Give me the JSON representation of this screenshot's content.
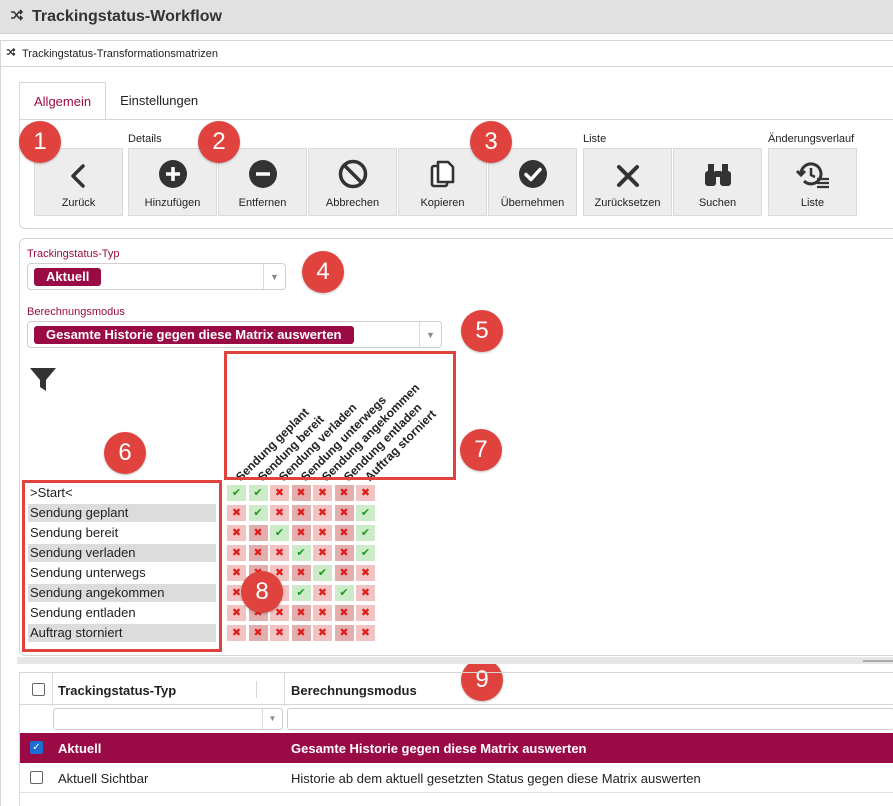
{
  "window": {
    "title": "Trackingstatus-Workflow"
  },
  "subwindow": {
    "title": "Trackingstatus-Transformationsmatrizen"
  },
  "tabs": [
    {
      "label": "Allgemein",
      "active": true
    },
    {
      "label": "Einstellungen",
      "active": false
    }
  ],
  "toolbar": {
    "groups": {
      "details": "Details",
      "liste": "Liste",
      "history": "Änderungsverlauf"
    },
    "buttons": {
      "back": "Zurück",
      "add": "Hinzufügen",
      "remove": "Entfernen",
      "cancel": "Abbrechen",
      "copy": "Kopieren",
      "apply": "Übernehmen",
      "reset": "Zurücksetzen",
      "search": "Suchen",
      "list": "Liste"
    }
  },
  "form": {
    "type_label": "Trackingstatus-Typ",
    "type_value": "Aktuell",
    "mode_label": "Berechnungsmodus",
    "mode_value": "Gesamte Historie gegen diese Matrix auswerten"
  },
  "matrix": {
    "columns": [
      "Sendung geplant",
      "Sendung bereit",
      "Sendung verladen",
      "Sendung unterwegs",
      "Sendung angekommen",
      "Sendung entladen",
      "Auftrag storniert"
    ],
    "rows": [
      {
        "label": ">Start<",
        "cells": [
          1,
          1,
          0,
          0,
          0,
          0,
          0
        ]
      },
      {
        "label": "Sendung geplant",
        "cells": [
          0,
          1,
          0,
          0,
          0,
          0,
          1
        ]
      },
      {
        "label": "Sendung bereit",
        "cells": [
          0,
          0,
          1,
          0,
          0,
          0,
          1
        ]
      },
      {
        "label": "Sendung verladen",
        "cells": [
          0,
          0,
          0,
          1,
          0,
          0,
          1
        ]
      },
      {
        "label": "Sendung unterwegs",
        "cells": [
          0,
          0,
          0,
          0,
          1,
          0,
          0
        ]
      },
      {
        "label": "Sendung angekommen",
        "cells": [
          0,
          0,
          0,
          1,
          0,
          1,
          0
        ]
      },
      {
        "label": "Sendung entladen",
        "cells": [
          0,
          0,
          0,
          0,
          0,
          0,
          0
        ]
      },
      {
        "label": "Auftrag storniert",
        "cells": [
          0,
          0,
          0,
          0,
          0,
          0,
          0
        ]
      }
    ]
  },
  "callouts": [
    "1",
    "2",
    "3",
    "4",
    "5",
    "6",
    "7",
    "8",
    "9"
  ],
  "grid": {
    "headers": {
      "type": "Trackingstatus-Typ",
      "mode": "Berechnungsmodus"
    },
    "rows": [
      {
        "type": "Aktuell",
        "mode": "Gesamte Historie gegen diese Matrix auswerten",
        "checked": true
      },
      {
        "type": "Aktuell Sichtbar",
        "mode": "Historie ab dem aktuell gesetzten Status gegen diese Matrix auswerten",
        "checked": false
      }
    ]
  },
  "colors": {
    "accent": "#9a0b45",
    "callout": "#e0433e",
    "allowed": "#1e9a1e",
    "denied": "#e01c1c"
  }
}
